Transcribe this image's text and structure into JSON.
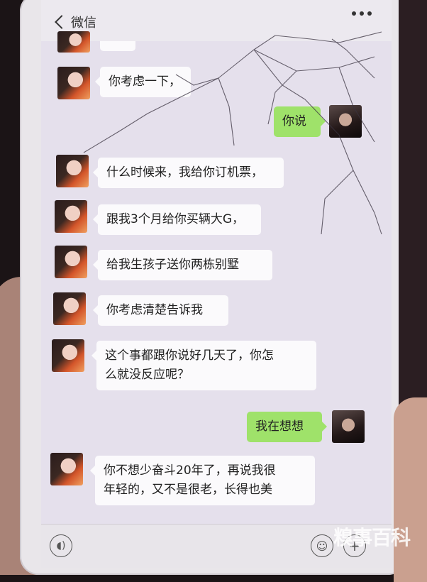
{
  "nav": {
    "back_label": "微信"
  },
  "messages": [
    {
      "side": "left",
      "text": "你考虑一下，"
    },
    {
      "side": "right",
      "text": "你说"
    },
    {
      "side": "left",
      "text": "什么时候来，我给你订机票，"
    },
    {
      "side": "left",
      "text": "跟我3个月给你买辆大G，"
    },
    {
      "side": "left",
      "text": "给我生孩子送你两栋别墅"
    },
    {
      "side": "left",
      "text": "你考虑清楚告诉我"
    },
    {
      "side": "left",
      "text_line1": "这个事都跟你说好几天了，你怎",
      "text_line2": "么就没反应呢？"
    },
    {
      "side": "right",
      "text": "我在想想"
    },
    {
      "side": "left",
      "text_line1": "你不想少奋斗20年了，再说我很",
      "text_line2": "年轻的，又不是很老，长得也美"
    }
  ],
  "input_bar": {
    "voice_icon": "voice-icon",
    "emoji_icon": "emoji-icon",
    "add_icon": "plus-icon"
  },
  "watermark": "糗事百科",
  "colors": {
    "sent_bubble": "#9fe26a",
    "received_bubble": "#fbfafc",
    "chat_bg": "#e5e0ec"
  }
}
